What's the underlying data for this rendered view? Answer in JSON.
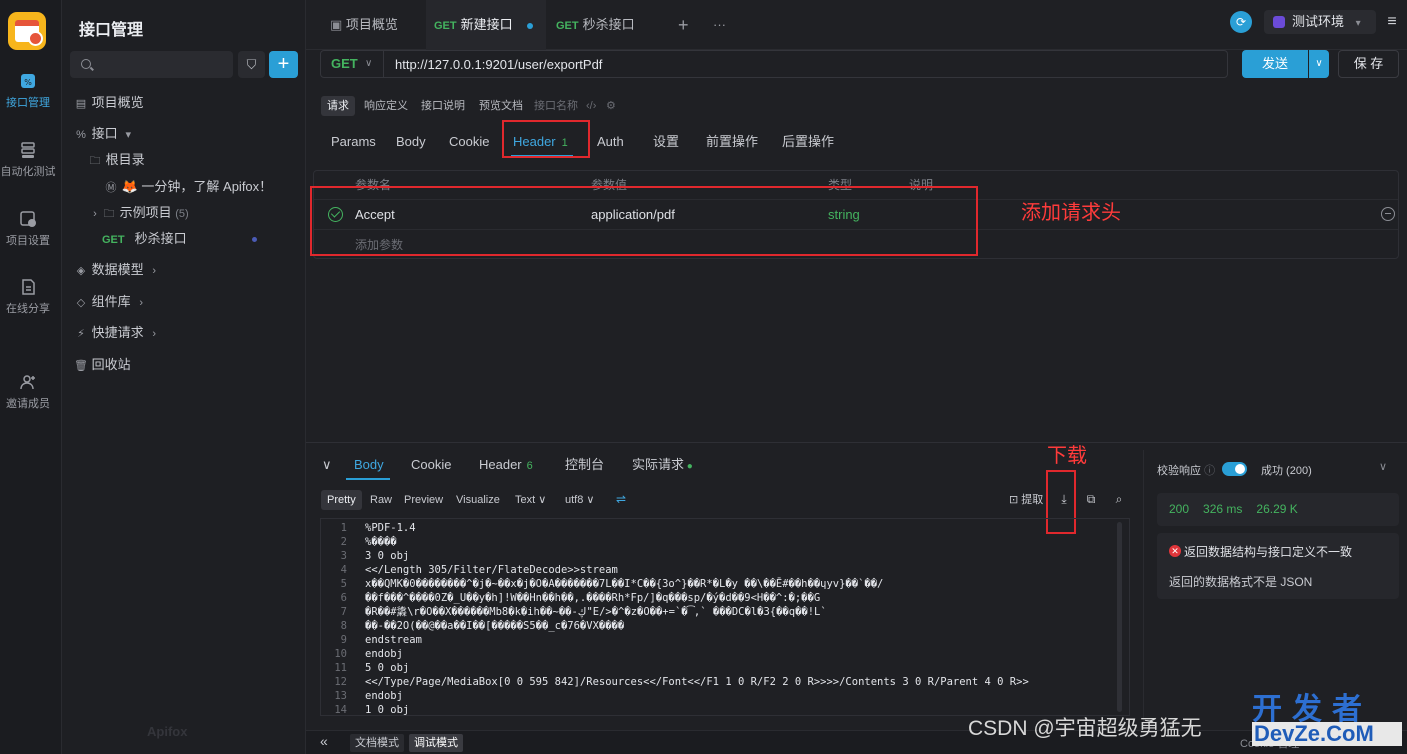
{
  "rail": {
    "items": [
      {
        "label": "接口管理",
        "icon": "api-icon"
      },
      {
        "label": "自动化测试",
        "icon": "automation-icon"
      },
      {
        "label": "项目设置",
        "icon": "settings-icon"
      },
      {
        "label": "在线分享",
        "icon": "share-icon"
      },
      {
        "label": "邀请成员",
        "icon": "invite-icon"
      }
    ]
  },
  "sidebar": {
    "title": "接口管理",
    "tree": [
      {
        "label": "项目概览"
      },
      {
        "label": "接口",
        "chevron": "▾"
      },
      {
        "label": "根目录"
      },
      {
        "label": "🦊 一分钟，了解 Apifox！"
      },
      {
        "label": "示例项目",
        "count": "(5)"
      },
      {
        "method": "GET",
        "label": "秒杀接口"
      },
      {
        "label": "数据模型"
      },
      {
        "label": "组件库"
      },
      {
        "label": "快捷请求"
      },
      {
        "label": "回收站"
      }
    ],
    "watermark": "Apifox"
  },
  "tabs": {
    "items": [
      {
        "label": "项目概览"
      },
      {
        "method": "GET",
        "label": "新建接口"
      },
      {
        "method": "GET",
        "label": "秒杀接口"
      }
    ],
    "add": "+",
    "more": "···",
    "env": "测试环境"
  },
  "request": {
    "method": "GET",
    "url": "http://127.0.0.1:9201/user/exportPdf",
    "send": "发送",
    "save": "保 存",
    "modes": [
      "请求",
      "响应定义",
      "接口说明",
      "预览文档",
      "接口名称"
    ],
    "tabs": [
      "Params",
      "Body",
      "Cookie",
      "Header",
      "Auth",
      "设置",
      "前置操作",
      "后置操作"
    ],
    "header_count": "1",
    "table": {
      "columns": [
        "参数名",
        "参数值",
        "类型",
        "说明"
      ],
      "rows": [
        {
          "name": "Accept",
          "value": "application/pdf",
          "type": "string"
        }
      ],
      "add_placeholder": "添加参数"
    }
  },
  "annotations": {
    "add_header": "添加请求头",
    "download": "下载"
  },
  "response": {
    "tabs": [
      "Body",
      "Cookie",
      "Header",
      "控制台",
      "实际请求"
    ],
    "header_count": "6",
    "formats": [
      "Pretty",
      "Raw",
      "Preview",
      "Visualize"
    ],
    "text_select": "Text",
    "encoding_select": "utf8",
    "extract": "提取",
    "lines": [
      "%PDF-1.4",
      "%����",
      "3 0 obj",
      "<</Length 305/Filter/FlateDecode>>stream",
      "x��QMK�0��������^�j�~��x�j�O�A�������7L��I*C��{3o^}��R*�L�y ��\\��Ē#��h��ɥyv}��`��/",
      "��f���^����0Z�_U��y�h]!W��Hn��h��,.����Rh*Fp/]�q���sp/�ý�d��9<H��^:�;��G",
      "�R��#䵈\\r�O��X������Mb8�k�ih��~��-ڮ\"E/>�^�z�O��+=`�͡,` ���DC�l�3{��q��!L`",
      "��-��2O(��@��a��I��[�����S5��_c�76�VX����",
      "endstream",
      "endobj",
      "5 0 obj",
      "<</Type/Page/MediaBox[0 0 595 842]/Resources<</Font<</F1 1 0 R/F2 2 0 R>>>>/Contents 3 0 R/Parent 4 0 R>>",
      "endobj",
      "1 0 obj"
    ],
    "validate": {
      "label": "校验响应",
      "status": "成功 (200)",
      "code": "200",
      "time": "326 ms",
      "size": "26.29 K",
      "error_title": "返回数据结构与接口定义不一致",
      "error_msg": "返回的数据格式不是 JSON"
    }
  },
  "bottom": {
    "modes": [
      "文档模式",
      "调试模式"
    ],
    "cookie": "Cookie 管理"
  },
  "watermarks": {
    "csdn": "CSDN @宇宙超级勇猛无",
    "brand_top": "开发者",
    "brand_bottom": "DevZe.CoM"
  },
  "colors": {
    "accent": "#2a9fd6",
    "get": "#44b35f",
    "annotation": "#e0282d"
  }
}
